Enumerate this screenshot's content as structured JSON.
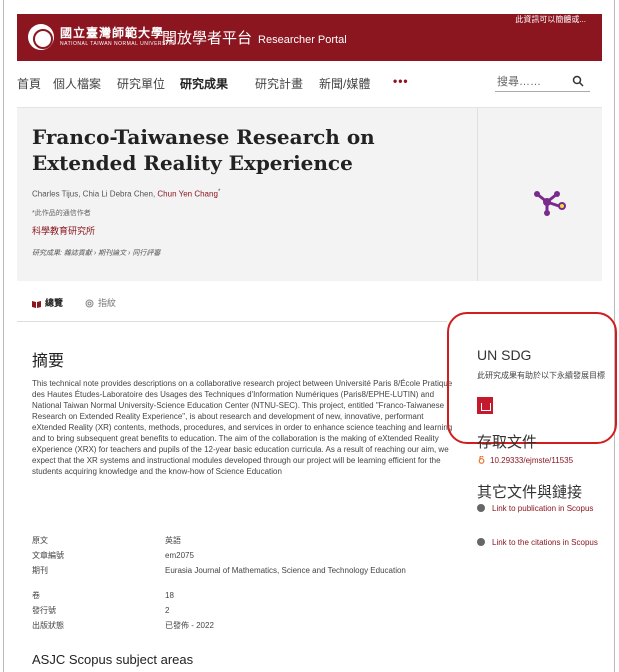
{
  "header": {
    "logo_text": "國立臺灣師範大學",
    "logo_subtext": "NATIONAL TAIWAN NORMAL UNIVERSITY",
    "portal_title_zh": "開放學者平台",
    "portal_title_en": "Researcher Portal",
    "top_link": "此資訊可以簡體或..."
  },
  "nav": {
    "items": [
      "首頁",
      "個人檔案",
      "研究單位",
      "研究成果",
      "研究計畫",
      "新聞/媒體"
    ],
    "active_index": 3,
    "more": "•••",
    "search_placeholder": "搜尋……"
  },
  "publication": {
    "title": "Franco-Taiwanese Research on Extended Reality Experience",
    "authors_plain": "Charles Tijus, Chia Li Debra Chen, ",
    "author_highlight": "Chun Yen Chang",
    "author_mark": "*",
    "footnote": "*此作品的通信作者",
    "unit": "科學教育研究所",
    "type": "研究成果: 雜誌貢獻 › 期刊論文 › 同行評審"
  },
  "tabs": [
    {
      "label": "總覽",
      "icon": "book-icon",
      "active": true
    },
    {
      "label": "指紋",
      "icon": "fingerprint-icon",
      "active": false
    }
  ],
  "abstract": {
    "heading": "摘要",
    "text": "This technical note provides descriptions on a collaborative research project between Université Paris 8/École Pratique des Hautes Études-Laboratoire des Usages des Techniques d'Information Numériques (Paris8/EPHE-LUTIN) and National Taiwan Normal University-Science Education Center (NTNU-SEC). This project, entitled \"Franco-Taiwanese Research on Extended Reality Experience\", is about research and development of new, innovative, performant eXtended Reality (XR) contents, methods, procedures, and services in order to enhance science teaching and learning and to bring subsequent great benefits to education. The aim of the collaboration is the making of eXtended Reality eXperience (XRX) for teachers and pupils of the 12-year basic education curricula. As a result of reaching our aim, we expect that the XR systems and instructional modules developed through our project will be learning efficient for the students acquiring knowledge and the know-how of Science Education"
  },
  "metadata": [
    {
      "label": "原文",
      "value": "英語"
    },
    {
      "label": "文章編號",
      "value": "em2075"
    },
    {
      "label": "期刊",
      "value": "Eurasia Journal of Mathematics, Science and Technology Education"
    },
    {
      "label": "卷",
      "value": "18"
    },
    {
      "label": "發行號",
      "value": "2"
    },
    {
      "label": "出版狀態",
      "value": "已發佈 - 2022"
    }
  ],
  "asjc_heading": "ASJC Scopus subject areas",
  "sidebar": {
    "sdg_heading": "UN SDG",
    "sdg_text": "此研究成果有助於以下永續發展目標",
    "access_heading": "存取文件",
    "doi": "10.29333/ejmste/11535",
    "other_heading": "其它文件與鏈接",
    "links": [
      "Link to publication in Scopus",
      "Link to the citations in Scopus"
    ]
  },
  "colors": {
    "brand": "#8b1620",
    "annotation": "#d11d1d",
    "sdg4": "#c5192d"
  }
}
